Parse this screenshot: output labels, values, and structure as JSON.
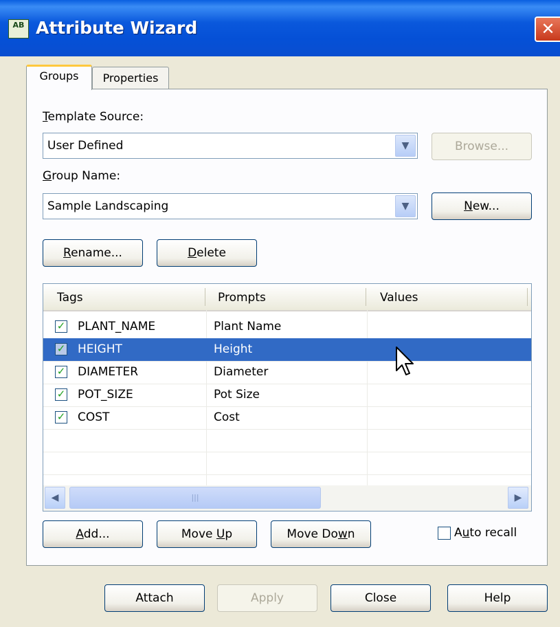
{
  "window": {
    "title": "Attribute Wizard",
    "icon_text": "AB",
    "close_glyph": "✕"
  },
  "tabs": [
    {
      "label": "Groups"
    },
    {
      "label": "Properties"
    }
  ],
  "template_source": {
    "label_pre": "",
    "label_u": "T",
    "label_post": "emplate Source:",
    "value": "User Defined",
    "browse_label": "Browse..."
  },
  "group_name": {
    "label_u": "G",
    "label_post": "roup Name:",
    "value": "Sample Landscaping",
    "new_u": "N",
    "new_post": "ew..."
  },
  "rename": {
    "u": "R",
    "post": "ename..."
  },
  "delete": {
    "u": "D",
    "post": "elete"
  },
  "table": {
    "columns": [
      "Tags",
      "Prompts",
      "Values"
    ],
    "rows": [
      {
        "tag": "PLANT_NAME",
        "prompt": "Plant Name",
        "value": "",
        "checked": true,
        "selected": false
      },
      {
        "tag": "HEIGHT",
        "prompt": "Height",
        "value": "",
        "checked": true,
        "selected": true
      },
      {
        "tag": "DIAMETER",
        "prompt": "Diameter",
        "value": "",
        "checked": true,
        "selected": false
      },
      {
        "tag": "POT_SIZE",
        "prompt": "Pot Size",
        "value": "",
        "checked": true,
        "selected": false
      },
      {
        "tag": "COST",
        "prompt": "Cost",
        "value": "",
        "checked": true,
        "selected": false
      }
    ],
    "scroll_thumb_glyph": "|||"
  },
  "buttons": {
    "add": {
      "u": "A",
      "post": "dd..."
    },
    "move_up": {
      "pre": "Move ",
      "u": "U",
      "post": "p"
    },
    "move_down": {
      "pre": "Move Do",
      "u": "w",
      "post": "n"
    },
    "auto_recall": {
      "pre": "A",
      "u": "u",
      "post": "to recall",
      "checked": false
    },
    "attach": "Attach",
    "apply": "Apply",
    "close": "Close",
    "help": "Help"
  },
  "colors": {
    "titlebar": "#0a58dc",
    "selection": "#316ac5",
    "dialog_bg": "#ece9d8"
  }
}
